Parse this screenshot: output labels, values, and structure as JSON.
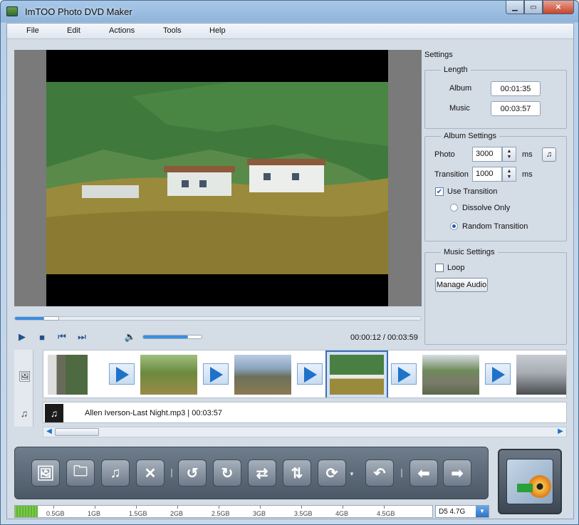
{
  "window": {
    "title": "ImTOO Photo DVD Maker"
  },
  "menu": [
    "File",
    "Edit",
    "Actions",
    "Tools",
    "Help"
  ],
  "player": {
    "time": "00:00:12 / 00:03:59",
    "seek_fraction": 0.08,
    "volume_fraction": 0.77
  },
  "settings": {
    "label": "Settings",
    "length": {
      "title": "Length",
      "album_label": "Album",
      "album_value": "00:01:35",
      "music_label": "Music",
      "music_value": "00:03:57"
    },
    "album": {
      "title": "Album Settings",
      "photo_label": "Photo",
      "photo_value": "3000",
      "photo_unit": "ms",
      "transition_label": "Transition",
      "transition_value": "1000",
      "transition_unit": "ms",
      "use_transition_label": "Use Transition",
      "use_transition_checked": true,
      "dissolve_label": "Dissolve Only",
      "random_label": "Random Transition",
      "selected": "Random Transition"
    },
    "music": {
      "title": "Music Settings",
      "loop_label": "Loop",
      "loop_checked": false,
      "manage_label": "Manage Audio"
    }
  },
  "storyboard": {
    "music_track": "Allen Iverson-Last Night.mp3 | 00:03:57"
  },
  "capacity": {
    "ticks": [
      "0.5GB",
      "1GB",
      "1.5GB",
      "2GB",
      "2.5GB",
      "3GB",
      "3.5GB",
      "4GB",
      "4.5GB"
    ],
    "fill_fraction": 0.055,
    "disc": "D5 4.7G"
  },
  "colors": {
    "accent": "#1f72c9",
    "capacity": "#6cc23f"
  }
}
